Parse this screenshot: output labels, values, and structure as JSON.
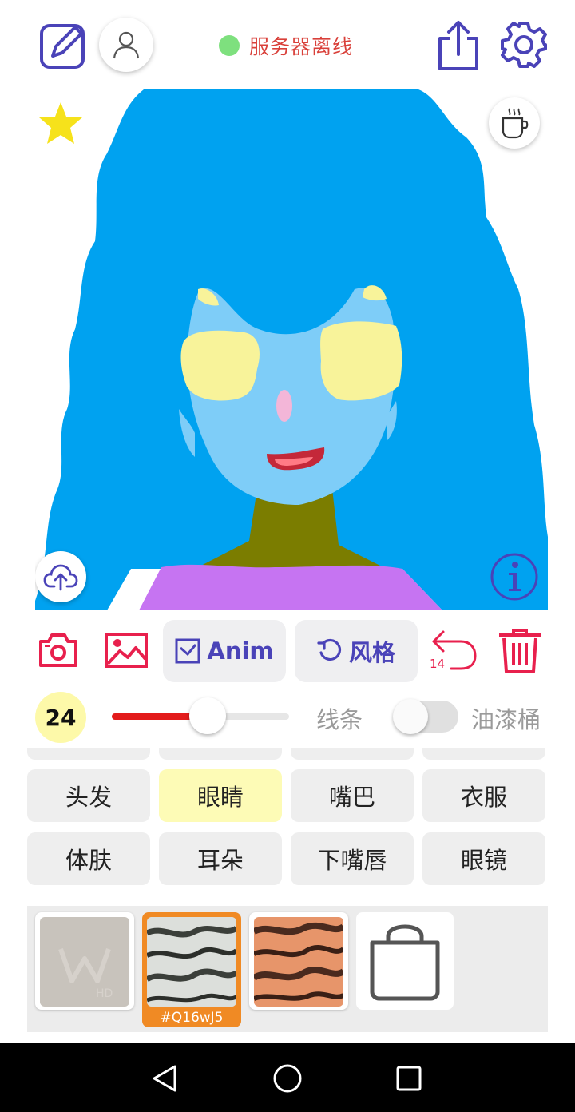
{
  "app": {
    "status_text": "服务器离线",
    "status_color": "#d9403a",
    "status_dot_color": "#7ee07e",
    "accent_color": "#4a43b8",
    "danger_color": "#e8204d"
  },
  "topbar": {
    "icons": [
      "edit-icon",
      "user-icon",
      "share-icon",
      "settings-icon"
    ]
  },
  "canvas": {
    "overlay_icons": [
      "star-icon",
      "coffee-icon",
      "cloud-upload-icon",
      "info-icon"
    ]
  },
  "toolbar": {
    "anim_label": "Anim",
    "style_label": "风格",
    "undo_count": "14",
    "icons": [
      "camera-icon",
      "image-icon",
      "checkbox-icon",
      "refresh-icon",
      "undo-icon",
      "trash-icon"
    ]
  },
  "brush": {
    "size": "24",
    "size_badge_color": "#fdf9a9",
    "slider_fraction": 0.54,
    "slider_fill_color": "#e31b1b",
    "line_label": "线条",
    "bucket_label": "油漆桶",
    "bucket_enabled": false
  },
  "categories": {
    "row1": [
      "头发",
      "眼睛",
      "嘴巴",
      "衣服"
    ],
    "row2": [
      "体肤",
      "耳朵",
      "下嘴唇",
      "眼镜"
    ],
    "selected": "眼睛",
    "selected_color": "#fdfbb6"
  },
  "textures": {
    "items": [
      {
        "caption": ""
      },
      {
        "caption": "#Q16wJ5"
      },
      {
        "caption": ""
      },
      {
        "caption": ""
      }
    ],
    "selected_color": "#f08a24",
    "icons": [
      "blank-texture-icon",
      "shopping-bag-icon"
    ]
  },
  "navbar": {
    "icons": [
      "back-nav-icon",
      "home-nav-icon",
      "recents-nav-icon"
    ]
  }
}
